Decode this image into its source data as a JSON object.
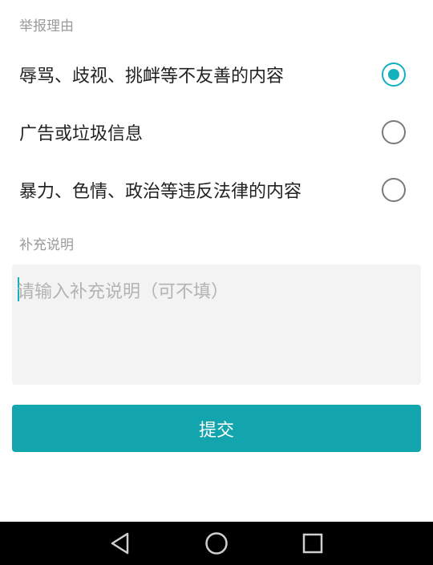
{
  "report": {
    "section_title": "举报理由",
    "options": [
      {
        "label": "辱骂、歧视、挑衅等不友善的内容",
        "selected": true
      },
      {
        "label": "广告或垃圾信息",
        "selected": false
      },
      {
        "label": "暴力、色情、政治等违反法律的内容",
        "selected": false
      }
    ]
  },
  "supplement": {
    "section_title": "补充说明",
    "placeholder": "请输入补充说明（可不填）",
    "value": ""
  },
  "submit_label": "提交",
  "colors": {
    "accent": "#13b0be",
    "button": "#12a5ae",
    "navbar": "#000000"
  },
  "navbar": {
    "icons": [
      "back-icon",
      "home-icon",
      "recent-apps-icon"
    ]
  }
}
